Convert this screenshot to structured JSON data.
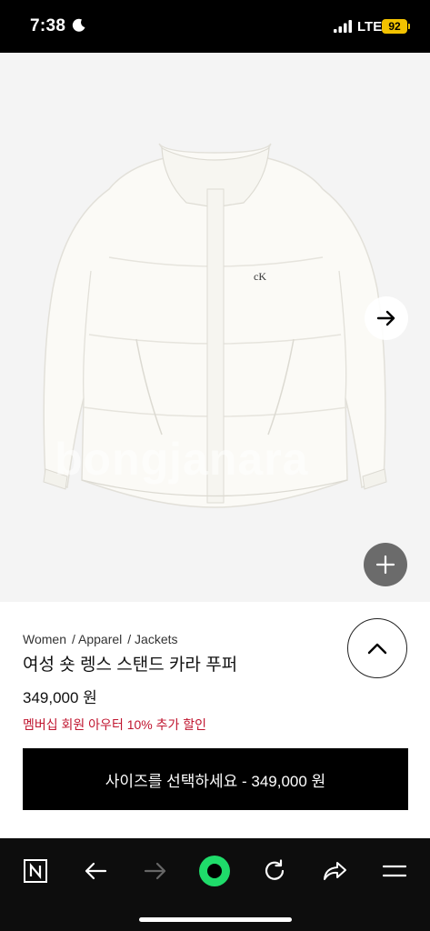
{
  "status_bar": {
    "time": "7:38",
    "network": "LTE",
    "battery": "92"
  },
  "product_image": {
    "watermark": "bongjanara",
    "logo_text": "cK"
  },
  "product": {
    "breadcrumb": [
      "Women",
      "/ Apparel",
      "/ Jackets"
    ],
    "title": "여성 숏 렝스 스탠드 카라 푸퍼",
    "price": "349,000 원",
    "promo": "멤버십 회원 아우터 10% 추가 할인",
    "faded_notice": "",
    "buy_button_label": "사이즈를 선택하세요 - 349,000 원"
  },
  "toolbar": {
    "items": [
      "naver-home",
      "back",
      "forward",
      "green-dot",
      "refresh",
      "share",
      "menu"
    ]
  },
  "colors": {
    "promo": "#c0152f",
    "green_dot": "#1fdb6a",
    "battery": "#f2c200"
  }
}
